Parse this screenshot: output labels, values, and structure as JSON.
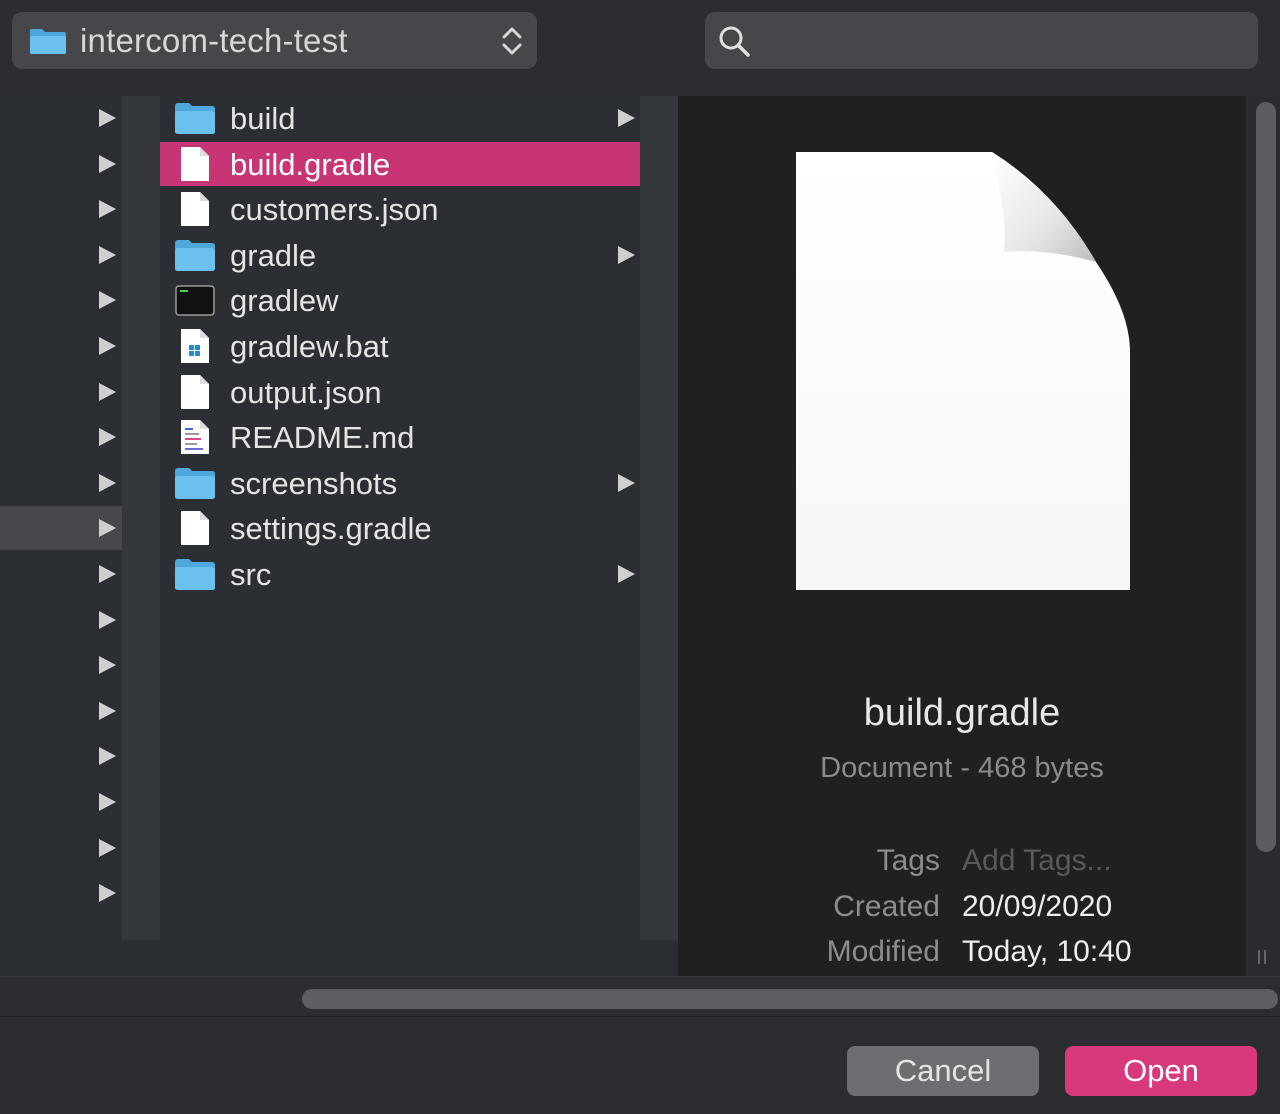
{
  "path_selector": {
    "label": "intercom-tech-test",
    "icon": "folder-icon"
  },
  "search": {
    "placeholder": "",
    "value": ""
  },
  "column1": {
    "selected_index": 9,
    "row_count": 18
  },
  "files": [
    {
      "name": "build",
      "type": "folder",
      "icon": "folder-icon",
      "has_children": true,
      "selected": false
    },
    {
      "name": "build.gradle",
      "type": "document",
      "icon": "document-icon",
      "has_children": false,
      "selected": true
    },
    {
      "name": "customers.json",
      "type": "document",
      "icon": "document-icon",
      "has_children": false,
      "selected": false
    },
    {
      "name": "gradle",
      "type": "folder",
      "icon": "folder-icon",
      "has_children": true,
      "selected": false
    },
    {
      "name": "gradlew",
      "type": "executable",
      "icon": "terminal-icon",
      "has_children": false,
      "selected": false
    },
    {
      "name": "gradlew.bat",
      "type": "batch",
      "icon": "windows-file-icon",
      "has_children": false,
      "selected": false
    },
    {
      "name": "output.json",
      "type": "document",
      "icon": "document-icon",
      "has_children": false,
      "selected": false
    },
    {
      "name": "README.md",
      "type": "markdown",
      "icon": "text-document-icon",
      "has_children": false,
      "selected": false
    },
    {
      "name": "screenshots",
      "type": "folder",
      "icon": "folder-icon",
      "has_children": true,
      "selected": false
    },
    {
      "name": "settings.gradle",
      "type": "document",
      "icon": "document-icon",
      "has_children": false,
      "selected": false
    },
    {
      "name": "src",
      "type": "folder",
      "icon": "folder-icon",
      "has_children": true,
      "selected": false
    }
  ],
  "preview": {
    "name": "build.gradle",
    "kind": "Document - 468 bytes",
    "meta": [
      {
        "key": "Tags",
        "value": "Add Tags...",
        "placeholder": true
      },
      {
        "key": "Created",
        "value": "20/09/2020",
        "placeholder": false
      },
      {
        "key": "Modified",
        "value": "Today, 10:40",
        "placeholder": false
      }
    ]
  },
  "buttons": {
    "cancel": "Cancel",
    "open": "Open"
  },
  "colors": {
    "accent": "#d8397c",
    "selection": "#c83575",
    "folder": "#5fb4e6"
  }
}
